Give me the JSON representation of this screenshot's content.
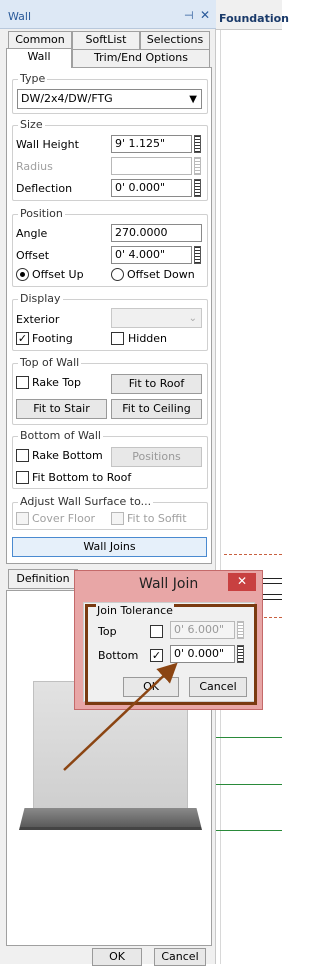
{
  "window": {
    "title": "Wall",
    "pin_glyph": "⊣",
    "close_glyph": "✕"
  },
  "right_pane": {
    "header": "Foundation"
  },
  "tabs_row1": [
    "Common",
    "SoftList",
    "Selections"
  ],
  "tabs_row2": [
    "Wall",
    "Trim/End Options"
  ],
  "type": {
    "label": "Type",
    "value": "DW/2x4/DW/FTG"
  },
  "size": {
    "label": "Size",
    "wall_height_label": "Wall Height",
    "wall_height_value": "9' 1.125\"",
    "radius_label": "Radius",
    "radius_value": "",
    "deflection_label": "Deflection",
    "deflection_value": "0' 0.000\""
  },
  "position": {
    "label": "Position",
    "angle_label": "Angle",
    "angle_value": "270.0000",
    "offset_label": "Offset",
    "offset_value": "0' 4.000\"",
    "offset_up_label": "Offset Up",
    "offset_down_label": "Offset Down"
  },
  "display": {
    "label": "Display",
    "exterior_label": "Exterior",
    "footing_label": "Footing",
    "hidden_label": "Hidden"
  },
  "top_of_wall": {
    "label": "Top of Wall",
    "rake_top_label": "Rake Top",
    "fit_to_roof": "Fit to Roof",
    "fit_to_stair": "Fit to Stair",
    "fit_to_ceiling": "Fit to Ceiling"
  },
  "bottom_of_wall": {
    "label": "Bottom of Wall",
    "rake_bottom_label": "Rake Bottom",
    "positions": "Positions",
    "fit_bottom_label": "Fit Bottom to Roof"
  },
  "adjust_surface": {
    "label": "Adjust Wall Surface to...",
    "cover_floor_label": "Cover Floor",
    "fit_to_soffit_label": "Fit to Soffit"
  },
  "wall_joins_button": "Wall Joins",
  "definition_tab": "Definition",
  "footer": {
    "ok": "OK",
    "cancel": "Cancel"
  },
  "dialog": {
    "title": "Wall Join",
    "group_label": "Join Tolerance",
    "top_label": "Top",
    "top_value": "0' 6.000\"",
    "bottom_label": "Bottom",
    "bottom_value": "0' 0.000\"",
    "ok": "OK",
    "cancel": "Cancel"
  },
  "colors": {
    "highlight_box": "#7a3a10",
    "arrow": "#8b4513",
    "dialog_bg": "#e8a6a6",
    "title_text": "#2a5a9a"
  }
}
